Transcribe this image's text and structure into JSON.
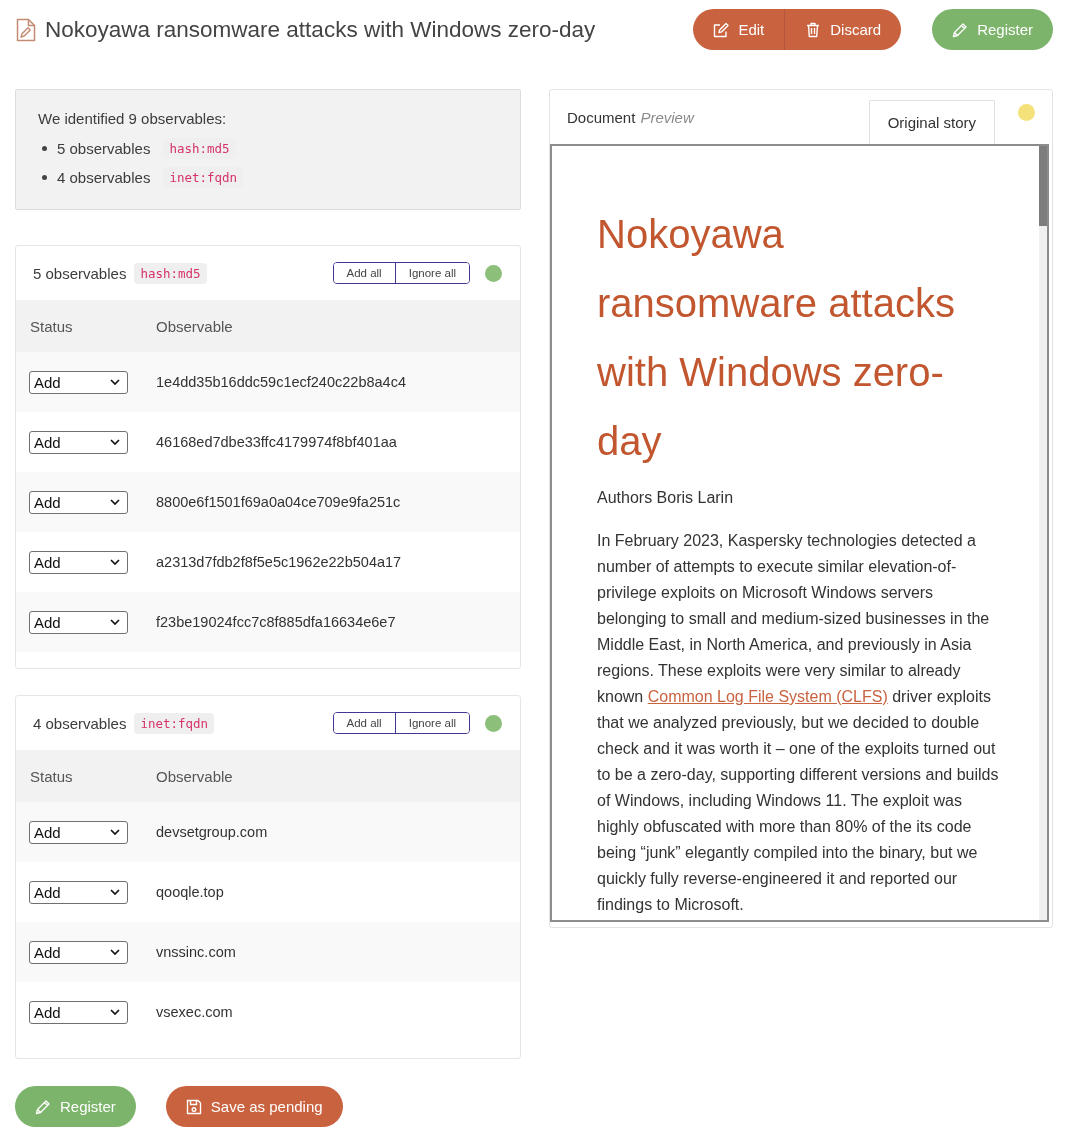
{
  "header": {
    "title": "Nokoyawa ransomware attacks with Windows zero-day",
    "button_groups": [
      {
        "buttons": [
          {
            "kind": "edit",
            "label": "Edit"
          },
          {
            "kind": "discard",
            "label": "Discard"
          }
        ]
      },
      {
        "buttons": [
          {
            "kind": "register",
            "label": "Register"
          }
        ]
      }
    ]
  },
  "summary": {
    "heading": "We identified 9 observables:",
    "items": [
      {
        "count": "5 observables",
        "type": "hash:md5"
      },
      {
        "count": "4 observables",
        "type": "inet:fqdn"
      }
    ]
  },
  "groups": [
    {
      "count": "5 observables",
      "type": "hash:md5",
      "actions": [
        "Add all",
        "Ignore all"
      ],
      "color": "#8cc07a",
      "columns": [
        "Status",
        "Observable"
      ],
      "rows": [
        {
          "status": "Add",
          "value": "1e4dd35b16ddc59c1ecf240c22b8a4c4"
        },
        {
          "status": "Add",
          "value": "46168ed7dbe33ffc4179974f8bf401aa"
        },
        {
          "status": "Add",
          "value": "8800e6f1501f69a0a04ce709e9fa251c"
        },
        {
          "status": "Add",
          "value": "a2313d7fdb2f8f5e5c1962e22b504a17"
        },
        {
          "status": "Add",
          "value": "f23be19024fcc7c8f885dfa16634e6e7"
        }
      ]
    },
    {
      "count": "4 observables",
      "type": "inet:fqdn",
      "actions": [
        "Add all",
        "Ignore all"
      ],
      "color": "#8cc07a",
      "columns": [
        "Status",
        "Observable"
      ],
      "rows": [
        {
          "status": "Add",
          "value": "devsetgroup.com"
        },
        {
          "status": "Add",
          "value": "qooqle.top"
        },
        {
          "status": "Add",
          "value": "vnssinc.com"
        },
        {
          "status": "Add",
          "value": "vsexec.com"
        }
      ]
    }
  ],
  "footer_buttons": [
    {
      "kind": "register",
      "label": "Register"
    },
    {
      "kind": "save",
      "label": "Save as pending"
    }
  ],
  "document": {
    "title": "Document",
    "subtitle": "Preview",
    "tabs": [
      {
        "label": "Original story",
        "selected": true
      }
    ],
    "color": "#f4e17a",
    "heading": "Nokoyawa ransomware attacks with Windows zero-day",
    "byline": "Authors Boris Larin",
    "body": [
      {
        "kind": "text",
        "text": "In February 2023, Kaspersky technologies detected a number of attempts to execute similar elevation-of-privilege exploits on Microsoft Windows servers belonging to small and medium-sized businesses in the Middle East, in North America, and previously in Asia regions. These exploits were very similar to already known "
      },
      {
        "kind": "link",
        "text": "Common Log File System (CLFS)"
      },
      {
        "kind": "text",
        "text": " driver exploits that we analyzed previously, but we decided to double check and it was worth it – one of the exploits turned out to be a zero-day, supporting different versions and builds of Windows, including Windows 11. The exploit was highly obfuscated with more than 80% of the its code being “junk” elegantly compiled into the binary, but we quickly fully reverse-engineered it and reported our findings to Microsoft."
      }
    ]
  }
}
